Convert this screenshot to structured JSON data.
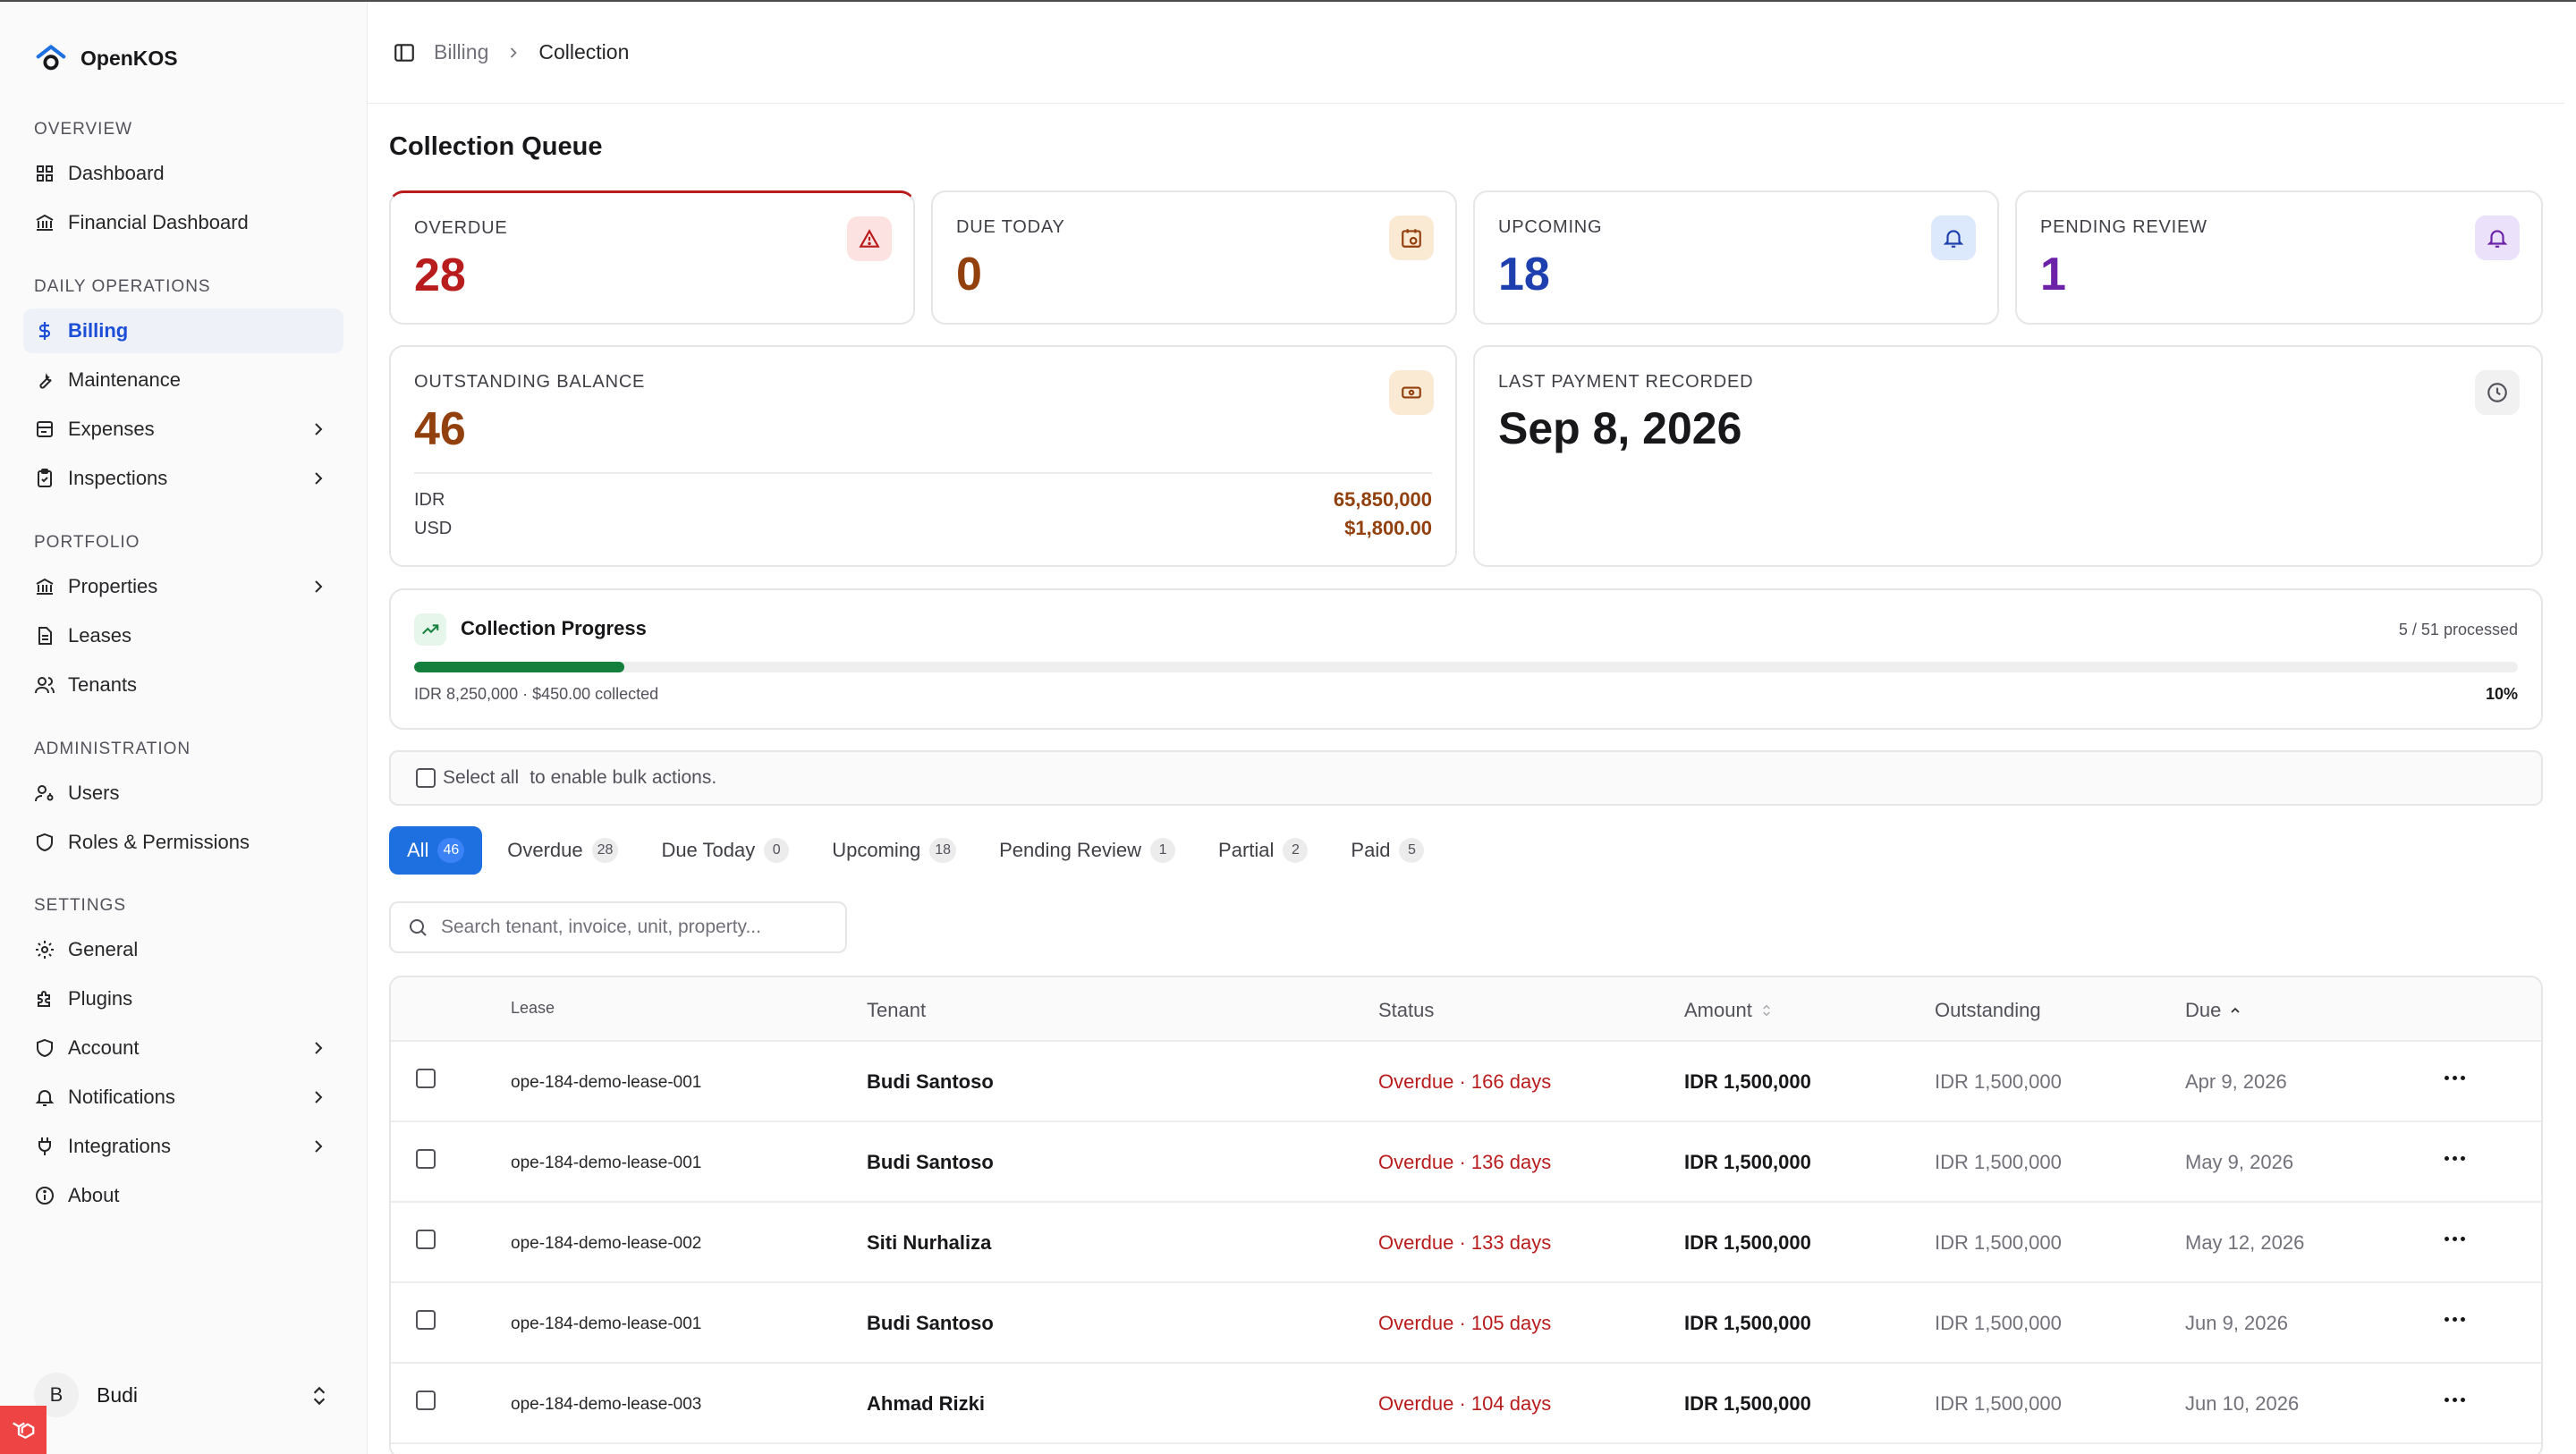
{
  "app": {
    "name": "OpenKOS"
  },
  "sidebar": {
    "sections": [
      {
        "title": "OVERVIEW"
      },
      {
        "title": "DAILY OPERATIONS"
      },
      {
        "title": "PORTFOLIO"
      },
      {
        "title": "ADMINISTRATION"
      },
      {
        "title": "SETTINGS"
      }
    ],
    "items": [
      {
        "label": "Dashboard",
        "icon": "grid-icon"
      },
      {
        "label": "Financial Dashboard",
        "icon": "bank-icon"
      },
      {
        "label": "Billing",
        "icon": "dollar-icon",
        "active": true
      },
      {
        "label": "Maintenance",
        "icon": "wrench-icon"
      },
      {
        "label": "Expenses",
        "icon": "receipt-icon"
      },
      {
        "label": "Inspections",
        "icon": "clipboard-check-icon"
      },
      {
        "label": "Properties",
        "icon": "building-icon"
      },
      {
        "label": "Leases",
        "icon": "file-text-icon"
      },
      {
        "label": "Tenants",
        "icon": "users-icon"
      },
      {
        "label": "Users",
        "icon": "user-key-icon"
      },
      {
        "label": "Roles & Permissions",
        "icon": "shield-icon"
      },
      {
        "label": "General",
        "icon": "gear-icon"
      },
      {
        "label": "Plugins",
        "icon": "puzzle-icon"
      },
      {
        "label": "Account",
        "icon": "shield-icon"
      },
      {
        "label": "Notifications",
        "icon": "bell-icon"
      },
      {
        "label": "Integrations",
        "icon": "plug-icon"
      },
      {
        "label": "About",
        "icon": "info-icon"
      }
    ],
    "user": {
      "initial": "B",
      "name": "Budi"
    }
  },
  "breadcrumb": {
    "parent": "Billing",
    "current": "Collection"
  },
  "page": {
    "title": "Collection Queue"
  },
  "stats": {
    "overdue": {
      "label": "OVERDUE",
      "value": "28",
      "color": "#b91c1c"
    },
    "due_today": {
      "label": "DUE TODAY",
      "value": "0",
      "color": "#92400e"
    },
    "upcoming": {
      "label": "UPCOMING",
      "value": "18",
      "color": "#1e40af"
    },
    "pending_review": {
      "label": "PENDING REVIEW",
      "value": "1",
      "color": "#6b21a8"
    },
    "outstanding": {
      "label": "OUTSTANDING BALANCE",
      "value": "46",
      "idr_label": "IDR",
      "idr_value": "65,850,000",
      "usd_label": "USD",
      "usd_value": "$1,800.00"
    },
    "last_payment": {
      "label": "LAST PAYMENT RECORDED",
      "value": "Sep 8, 2026"
    }
  },
  "progress": {
    "title": "Collection Progress",
    "processed": "5 / 51 processed",
    "collected": "IDR 8,250,000 · $450.00 collected",
    "percent_label": "10%",
    "fraction": 0.1
  },
  "bulk": {
    "select_all": "Select all",
    "hint": "to enable bulk actions."
  },
  "tabs": [
    {
      "label": "All",
      "count": "46",
      "active": true
    },
    {
      "label": "Overdue",
      "count": "28"
    },
    {
      "label": "Due Today",
      "count": "0"
    },
    {
      "label": "Upcoming",
      "count": "18"
    },
    {
      "label": "Pending Review",
      "count": "1"
    },
    {
      "label": "Partial",
      "count": "2"
    },
    {
      "label": "Paid",
      "count": "5"
    }
  ],
  "search": {
    "placeholder": "Search tenant, invoice, unit, property..."
  },
  "table": {
    "headers": {
      "lease": "Lease",
      "tenant": "Tenant",
      "status": "Status",
      "amount": "Amount",
      "outstanding": "Outstanding",
      "due": "Due"
    },
    "rows": [
      {
        "lease": "ope-184-demo-lease-001",
        "tenant": "Budi Santoso",
        "status": "Overdue · 166 days",
        "amount": "IDR 1,500,000",
        "outstanding": "IDR 1,500,000",
        "due": "Apr 9, 2026"
      },
      {
        "lease": "ope-184-demo-lease-001",
        "tenant": "Budi Santoso",
        "status": "Overdue · 136 days",
        "amount": "IDR 1,500,000",
        "outstanding": "IDR 1,500,000",
        "due": "May 9, 2026"
      },
      {
        "lease": "ope-184-demo-lease-002",
        "tenant": "Siti Nurhaliza",
        "status": "Overdue · 133 days",
        "amount": "IDR 1,500,000",
        "outstanding": "IDR 1,500,000",
        "due": "May 12, 2026"
      },
      {
        "lease": "ope-184-demo-lease-001",
        "tenant": "Budi Santoso",
        "status": "Overdue · 105 days",
        "amount": "IDR 1,500,000",
        "outstanding": "IDR 1,500,000",
        "due": "Jun 9, 2026"
      },
      {
        "lease": "ope-184-demo-lease-003",
        "tenant": "Ahmad Rizki",
        "status": "Overdue · 104 days",
        "amount": "IDR 1,500,000",
        "outstanding": "IDR 1,500,000",
        "due": "Jun 10, 2026"
      }
    ]
  }
}
